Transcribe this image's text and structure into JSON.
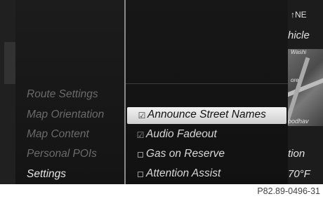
{
  "menu": {
    "items": [
      {
        "label": "Route Settings",
        "active": false
      },
      {
        "label": "Map Orientation",
        "active": false
      },
      {
        "label": "Map Content",
        "active": false
      },
      {
        "label": "Personal POIs",
        "active": false
      },
      {
        "label": "Settings",
        "active": true
      }
    ]
  },
  "settings": {
    "options": [
      {
        "label": "Announce Street Names",
        "checked": true,
        "selected": true
      },
      {
        "label": "Audio Fadeout",
        "checked": true,
        "selected": false
      },
      {
        "label": "Gas on Reserve",
        "checked": false,
        "selected": false
      },
      {
        "label": "Attention Assist",
        "checked": false,
        "selected": false
      }
    ],
    "check_icon": "check-icon",
    "empty_icon": "checkbox-empty-icon"
  },
  "map": {
    "compass": "NE",
    "vehicle_partial": "hicle",
    "street_top": "Washi",
    "street_mid": "ore",
    "street_low": "oodhav",
    "info_partial": "tion",
    "temperature_partial": "70°F"
  },
  "caption": "P82.89-0496-31",
  "colors": {
    "background": "#1a1a1a",
    "highlight": "#e8e8e8",
    "active_text": "#e4e4e4",
    "inactive_text": "#6b6b6b"
  }
}
